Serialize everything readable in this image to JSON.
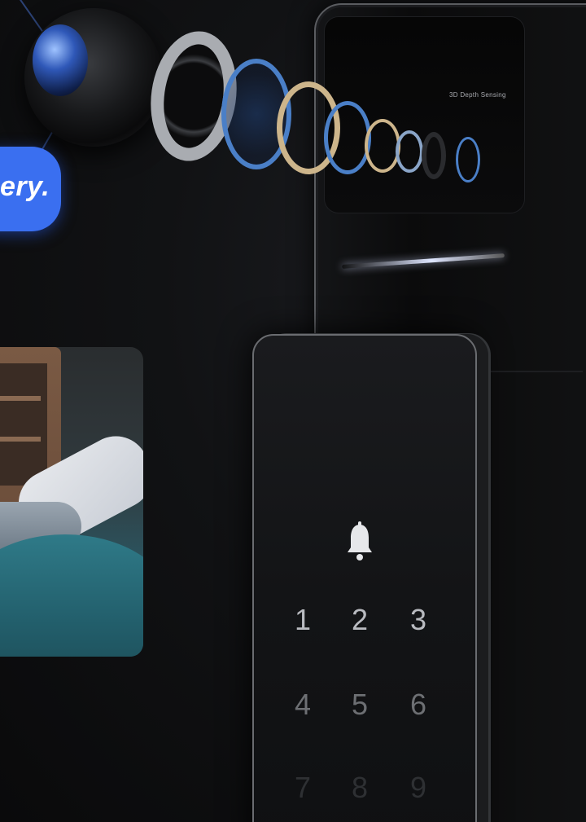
{
  "hero": {
    "tagline_fragment": "ery.",
    "sensor_label": "3D Depth Sensing"
  },
  "keypad": {
    "bell_icon": "bell-icon",
    "keys": [
      "1",
      "2",
      "3",
      "4",
      "5",
      "6",
      "7",
      "8",
      "9"
    ]
  },
  "colors": {
    "accent_blue": "#3a6ff0",
    "background": "#0d0d0f",
    "device_frame": "#5a5c60"
  }
}
